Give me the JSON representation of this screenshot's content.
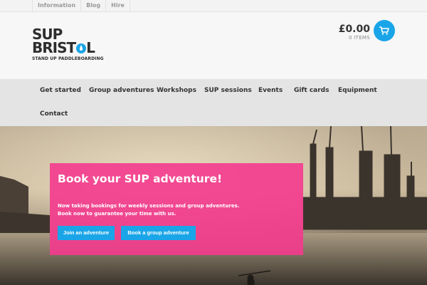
{
  "topbar": {
    "links": [
      "Information",
      "Blog",
      "Hire"
    ]
  },
  "logo": {
    "line1": "SUP",
    "line2_left": "BRIST",
    "line2_right": "L",
    "tagline": "STAND UP PADDLEBOARDING",
    "drop_color": "#1aa5e8"
  },
  "cart": {
    "amount": "£0.00",
    "items": "0 ITEMS",
    "icon": "cart-icon",
    "button_color": "#1aa5e8"
  },
  "nav": {
    "items": [
      "Get started",
      "Group adventures",
      "Workshops",
      "SUP sessions",
      "Events",
      "Gift cards",
      "Equipment",
      "Contact"
    ]
  },
  "hero": {
    "title": "Book your SUP adventure!",
    "line1": "Now taking bookings for weekly sessions and group adventures.",
    "line2": "Book now to guarantee your time with us.",
    "button1": "Join an adventure",
    "button2": "Book a group adventure",
    "promo_color": "#f43a8e",
    "button_color": "#1aa5e8"
  }
}
